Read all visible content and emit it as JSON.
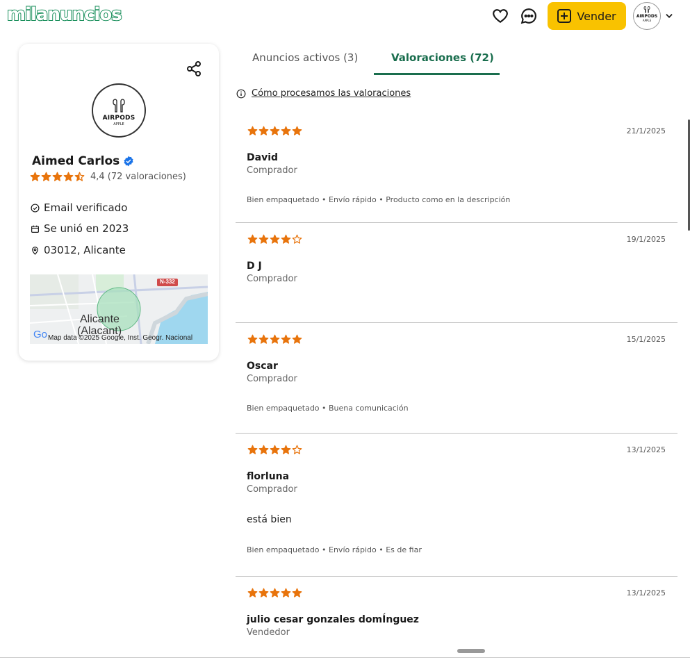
{
  "header": {
    "logo": "milanuncios",
    "sell_label": "Vender",
    "avatar_title": "AIRPODS",
    "avatar_sub": "APPLE"
  },
  "profile": {
    "avatar_title": "AIRPODS",
    "avatar_sub": "APPLE",
    "name": "Aimed Carlos",
    "rating": 4.4,
    "rating_text": "4,4 (72 valoraciones)",
    "email_verified": "Email verificado",
    "joined": "Se unió en 2023",
    "location": "03012, Alicante",
    "map": {
      "city": "Alicante",
      "city_alt": "(Alacant)",
      "road": "N-332",
      "attribution": "Map data ©2025 Google, Inst. Geogr. Nacional",
      "google_partial": "Go"
    }
  },
  "tabs": [
    {
      "label": "Anuncios activos (3)",
      "active": false
    },
    {
      "label": "Valoraciones (72)",
      "active": true
    }
  ],
  "info_link": "Cómo procesamos las valoraciones",
  "reviews": [
    {
      "stars": 5,
      "date": "21/1/2025",
      "name": "David",
      "role": "Comprador",
      "comment": "",
      "tags": "Bien empaquetado • Envío rápido • Producto como en la descripción"
    },
    {
      "stars": 4,
      "date": "19/1/2025",
      "name": "D J",
      "role": "Comprador",
      "comment": "",
      "tags": ""
    },
    {
      "stars": 5,
      "date": "15/1/2025",
      "name": "Oscar",
      "role": "Comprador",
      "comment": "",
      "tags": "Bien empaquetado • Buena comunicación"
    },
    {
      "stars": 4,
      "date": "13/1/2025",
      "name": "florluna",
      "role": "Comprador",
      "comment": "está bien",
      "tags": "Bien empaquetado • Envío rápido • Es de fiar"
    },
    {
      "stars": 5,
      "date": "13/1/2025",
      "name": "julio cesar gonzales domÍnguez",
      "role": "Vendedor",
      "comment": "",
      "tags": ""
    }
  ],
  "colors": {
    "star": "#e8740c",
    "accent": "#1a6e4e",
    "sell_bg": "#f9c200",
    "verified": "#1a73e8"
  }
}
